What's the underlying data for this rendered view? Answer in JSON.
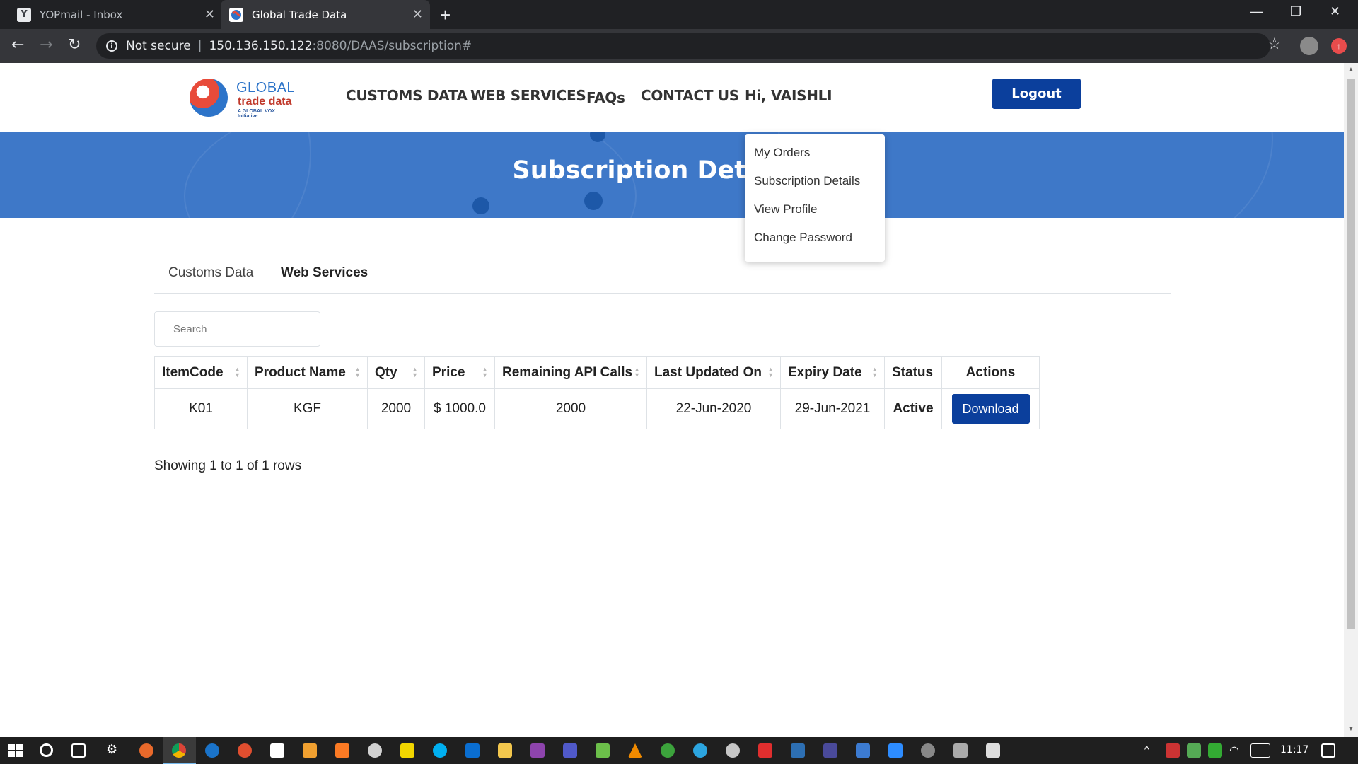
{
  "browser": {
    "tabs": [
      {
        "title": "YOPmail - Inbox",
        "icon": "Y"
      },
      {
        "title": "Global Trade Data",
        "icon": "globe"
      }
    ],
    "address": {
      "security": "Not secure",
      "host": "150.136.150.122",
      "path": ":8080/DAAS/subscription#"
    }
  },
  "site": {
    "logo": {
      "line1": "GLOBAL",
      "line2": "trade data",
      "line3": "A GLOBAL VOX Initiative"
    },
    "nav": [
      "CUSTOMS DATA",
      "WEB SERVICES",
      "FAQs",
      "CONTACT US",
      "Hi, VAISHLI"
    ],
    "logout_label": "Logout",
    "banner_title": "Subscription Details",
    "user_menu": [
      "My Orders",
      "Subscription Details",
      "View Profile",
      "Change Password"
    ]
  },
  "content": {
    "tabs": [
      "Customs Data",
      "Web Services"
    ],
    "active_tab": "Web Services",
    "search_placeholder": "Search",
    "table": {
      "headers": [
        "ItemCode",
        "Product Name",
        "Qty",
        "Price",
        "Remaining API Calls",
        "Last Updated On",
        "Expiry Date",
        "Status",
        "Actions"
      ],
      "rows": [
        {
          "item_code": "K01",
          "product_name": "KGF",
          "qty": "2000",
          "price": "$ 1000.0",
          "remaining_api_calls": "2000",
          "last_updated_on": "22-Jun-2020",
          "expiry_date": "29-Jun-2021",
          "status": "Active",
          "action": "Download"
        }
      ]
    },
    "pagination_text": "Showing 1 to 1 of 1 rows"
  },
  "taskbar": {
    "clock": "11:17"
  },
  "colors": {
    "primary_button": "#0b3f9c",
    "banner": "#3e78c8",
    "status_active": "#1c7a1c"
  }
}
